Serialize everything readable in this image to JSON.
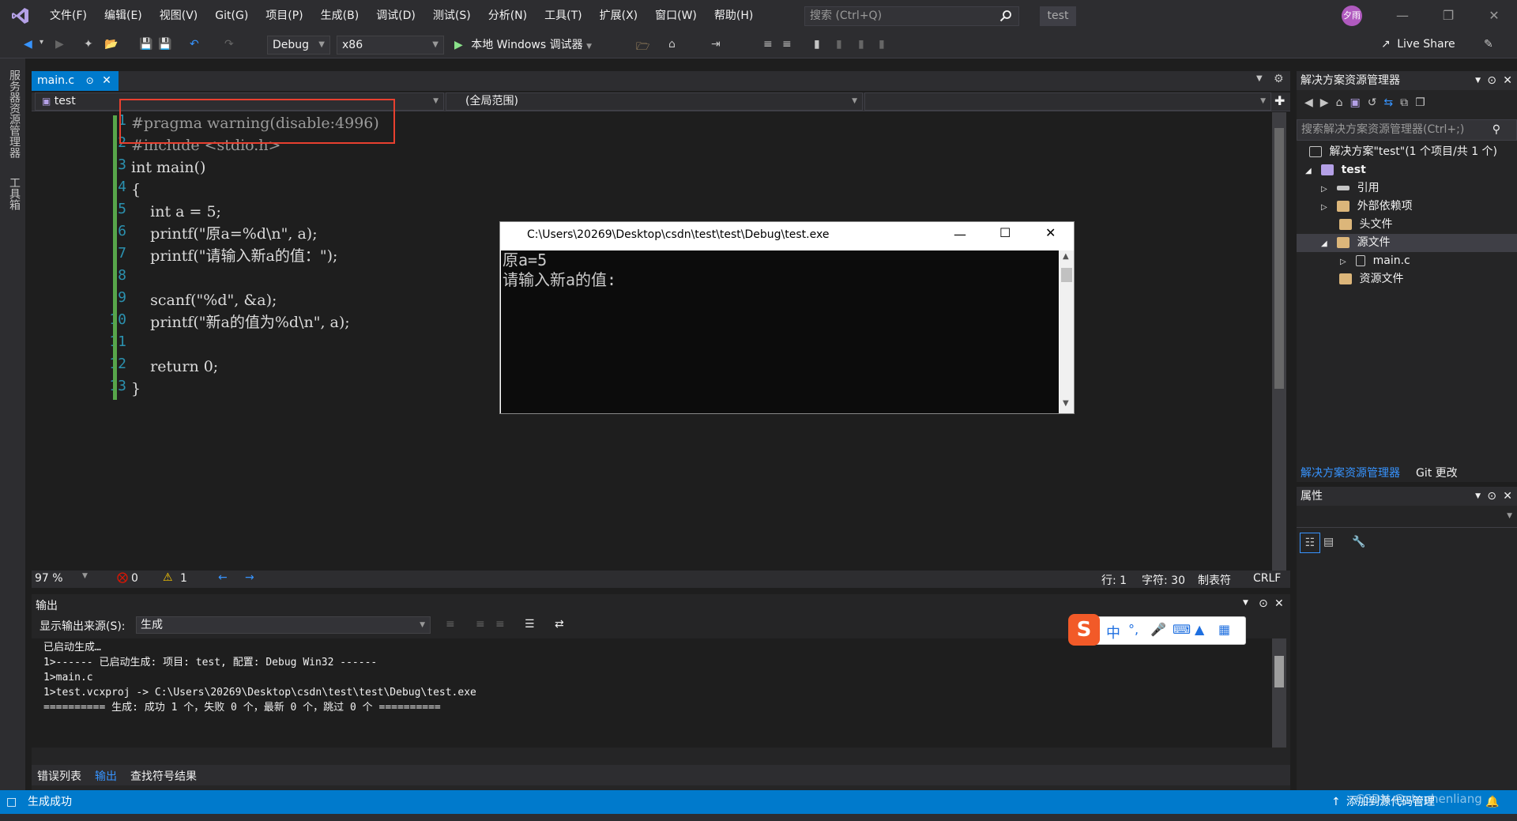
{
  "menu": {
    "items": [
      "文件(F)",
      "编辑(E)",
      "视图(V)",
      "Git(G)",
      "项目(P)",
      "生成(B)",
      "调试(D)",
      "测试(S)",
      "分析(N)",
      "工具(T)",
      "扩展(X)",
      "窗口(W)",
      "帮助(H)"
    ],
    "search_placeholder": "搜索 (Ctrl+Q)",
    "solution_badge": "test",
    "avatar_text": "夕雨"
  },
  "toolbar": {
    "config": "Debug",
    "platform": "x86",
    "run_label": "本地 Windows 调试器",
    "live_share": "Live Share"
  },
  "left_tabs": [
    "服务器资源管理器",
    "工具箱"
  ],
  "editor": {
    "tab_name": "main.c",
    "project_combo": "test",
    "scope_combo": "(全局范围)",
    "line_numbers": [
      "1",
      "2",
      "3",
      "4",
      "5",
      "6",
      "7",
      "8",
      "9",
      "10",
      "11",
      "12",
      "13"
    ],
    "zoom": "97 %",
    "errors": "0",
    "warnings": "1",
    "row": "行: 1",
    "col": "字符: 30",
    "indent": "制表符",
    "eol": "CRLF"
  },
  "code_lines": [
    "#pragma warning(disable:4996)",
    "#include <stdio.h>",
    "int main()",
    "{",
    "    int a = 5;",
    "    printf(\"原a=%d\\n\", a);",
    "    printf(\"请输入新a的值：\");",
    "",
    "    scanf(\"%d\", &a);",
    "    printf(\"新a的值为%d\\n\", a);",
    "",
    "    return 0;",
    "}"
  ],
  "console": {
    "title": "C:\\Users\\20269\\Desktop\\csdn\\test\\test\\Debug\\test.exe",
    "lines": [
      "原a=5",
      "请输入新a的值:"
    ]
  },
  "solution_explorer": {
    "title": "解决方案资源管理器",
    "search_placeholder": "搜索解决方案资源管理器(Ctrl+;)",
    "solution_label": "解决方案\"test\"(1 个项目/共 1 个)",
    "project": "test",
    "nodes": [
      "引用",
      "外部依赖项",
      "头文件",
      "源文件",
      "main.c",
      "资源文件"
    ],
    "tab_active": "解决方案资源管理器",
    "tab_git": "Git 更改"
  },
  "properties": {
    "title": "属性"
  },
  "output": {
    "title": "输出",
    "source_label": "显示输出来源(S):",
    "source_value": "生成",
    "lines": [
      "已启动生成…",
      "1>------ 已启动生成: 项目: test, 配置: Debug Win32 ------",
      "1>main.c",
      "1>test.vcxproj -> C:\\Users\\20269\\Desktop\\csdn\\test\\test\\Debug\\test.exe",
      "========== 生成: 成功 1 个，失败 0 个，最新 0 个，跳过 0 个 =========="
    ],
    "tabs": [
      "错误列表",
      "输出",
      "查找符号结果"
    ]
  },
  "ime": {
    "items": [
      "中",
      "°,",
      "🎤",
      "⌨",
      "👕",
      "▦"
    ]
  },
  "statusbar": {
    "status": "生成成功",
    "add_source": "添加到源代码管理",
    "watermark": "CSDN @stephenliang"
  }
}
